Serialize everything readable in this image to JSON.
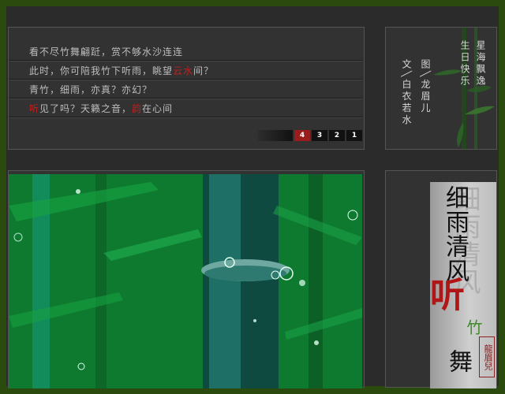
{
  "poem": {
    "lines": [
      [
        {
          "t": "看不尽竹舞翩跹，赏不够水沙连连",
          "c": ""
        }
      ],
      [
        {
          "t": "此时，你可陪我竹下听雨，眺望",
          "c": ""
        },
        {
          "t": "云水",
          "c": "red"
        },
        {
          "t": "间？",
          "c": ""
        }
      ],
      [
        {
          "t": "青竹，细雨，亦真？亦幻？",
          "c": ""
        }
      ],
      [
        {
          "t": "听",
          "c": "red"
        },
        {
          "t": "见了吗？天籁之音，",
          "c": ""
        },
        {
          "t": "韵",
          "c": "red"
        },
        {
          "t": "在心间",
          "c": ""
        }
      ]
    ],
    "pages": [
      "4",
      "3",
      "2",
      "1"
    ],
    "active_page": "4"
  },
  "signature": {
    "col1": "星海飘逸",
    "col2": "生日快乐",
    "col3": "图╲龙眉儿",
    "col4": "文╲白衣若水"
  },
  "calligraphy": {
    "line1": "细雨清风",
    "ting": "听",
    "zhu": "竹",
    "wu": "舞",
    "seal": "龍眉兒"
  },
  "colors": {
    "border_green": "#2b4a0e",
    "accent_red": "#c41e1e",
    "bamboo_green": "#139a3e"
  }
}
